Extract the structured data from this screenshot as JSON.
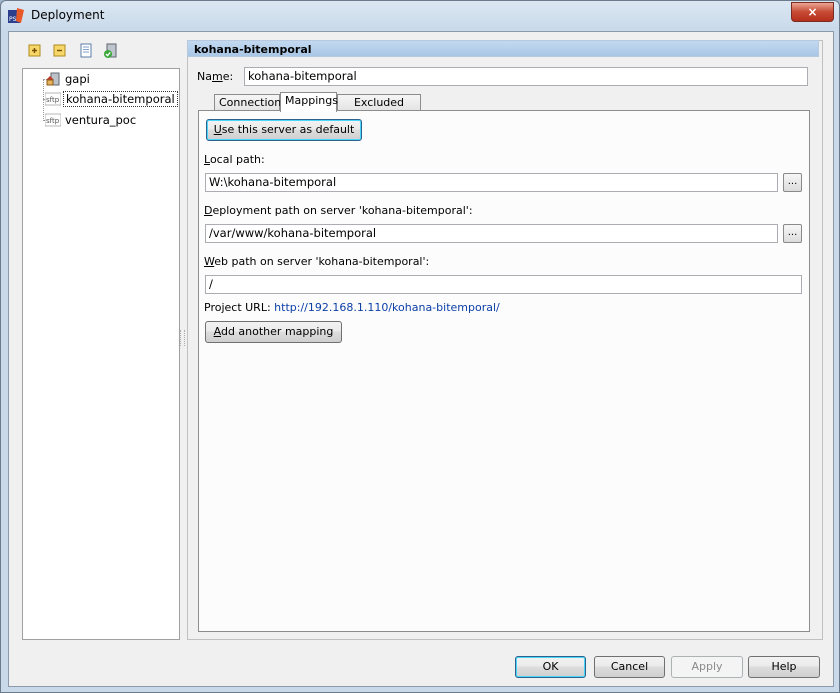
{
  "window": {
    "title": "Deployment",
    "close_glyph": "×"
  },
  "toolbar": {
    "buttons": [
      {
        "name": "add-server-icon",
        "glyph": "+"
      },
      {
        "name": "remove-server-icon",
        "glyph": "−"
      },
      {
        "name": "copy-server-icon",
        "glyph": ""
      },
      {
        "name": "set-default-icon",
        "glyph": ""
      }
    ]
  },
  "servers": {
    "items": [
      {
        "label": "gapi",
        "icon": "home-server-icon"
      },
      {
        "label": "kohana-bitemporal",
        "icon": "sftp-icon",
        "selected": true
      },
      {
        "label": "ventura_poc",
        "icon": "sftp-icon"
      }
    ],
    "sftp_text": "sftp"
  },
  "panel": {
    "header": "kohana-bitemporal",
    "name_label_pre": "Na",
    "name_label_mn": "m",
    "name_label_post": "e:",
    "name_value": "kohana-bitemporal",
    "tabs": [
      {
        "label": "Connection",
        "active": false
      },
      {
        "label": "Mappings",
        "active": true
      },
      {
        "label": "Excluded Paths",
        "active": false
      }
    ]
  },
  "mappings": {
    "use_default_label_u": "U",
    "use_default_label_rest": "se this server as default",
    "local_path_label_u": "L",
    "local_path_label_rest": "ocal path:",
    "local_path_value": "W:\\kohana-bitemporal",
    "deploy_path_label_pre": "D",
    "deploy_path_label_rest": "eployment path on server 'kohana-bitemporal':",
    "deploy_path_value": "/var/www/kohana-bitemporal",
    "web_path_label_u": "W",
    "web_path_label_rest": "eb path on server 'kohana-bitemporal':",
    "web_path_value": "/",
    "project_url_label": "Project URL:",
    "project_url_value": "http://192.168.1.110/kohana-bitemporal/",
    "add_mapping_label_pre": "A",
    "add_mapping_label_rest": "dd another mapping",
    "browse_glyph": "..."
  },
  "footer": {
    "ok": "OK",
    "cancel": "Cancel",
    "apply": "Apply",
    "help": "Help"
  }
}
